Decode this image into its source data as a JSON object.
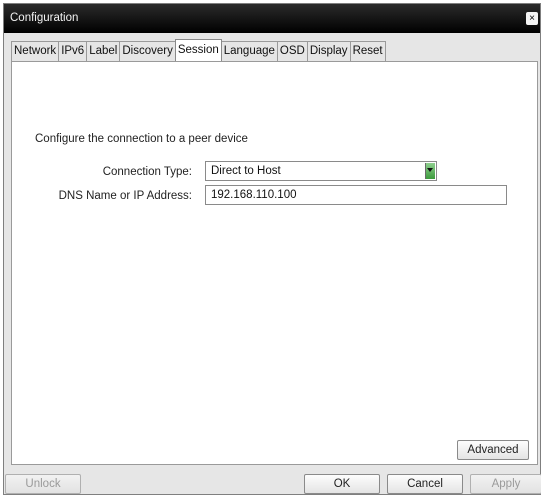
{
  "window": {
    "title": "Configuration",
    "close_glyph": "×"
  },
  "tabs": [
    {
      "label": "Network",
      "active": false
    },
    {
      "label": "IPv6",
      "active": false
    },
    {
      "label": "Label",
      "active": false
    },
    {
      "label": "Discovery",
      "active": false
    },
    {
      "label": "Session",
      "active": true
    },
    {
      "label": "Language",
      "active": false
    },
    {
      "label": "OSD",
      "active": false
    },
    {
      "label": "Display",
      "active": false
    },
    {
      "label": "Reset",
      "active": false
    }
  ],
  "session": {
    "intro": "Configure the connection to a peer device",
    "connection_type_label": "Connection Type:",
    "connection_type_value": "Direct to Host",
    "dns_label": "DNS Name or IP Address:",
    "dns_value": "192.168.110.100",
    "advanced_label": "Advanced"
  },
  "footer": {
    "unlock_label": "Unlock",
    "ok_label": "OK",
    "cancel_label": "Cancel",
    "apply_label": "Apply"
  },
  "colors": {
    "titlebar": "#000000",
    "dropdown_arrow": "#4caf50"
  },
  "icons": {
    "close": "close-icon",
    "dropdown": "dropdown-arrow-icon"
  }
}
